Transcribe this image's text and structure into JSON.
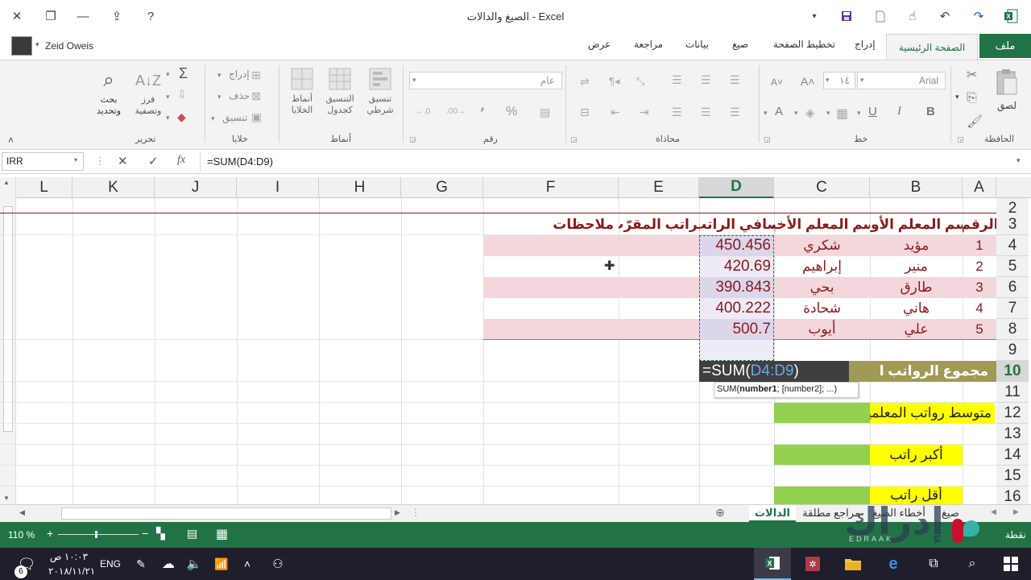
{
  "window": {
    "title": "الصيغ والدالات - Excel",
    "help": "?"
  },
  "account": {
    "name": "Zeid Oweis"
  },
  "ribbon_tabs": [
    "ملف",
    "الصفحة الرئيسية",
    "إدراج",
    "تخطيط الصفحة",
    "صيغ",
    "بيانات",
    "مراجعة",
    "عرض"
  ],
  "ribbon": {
    "groups": {
      "clipboard": "الحافظة",
      "font": "خط",
      "alignment": "محاذاة",
      "number": "رقم",
      "styles": "أنماط",
      "cells": "خلايا",
      "editing": "تحرير"
    },
    "paste": "لصق",
    "font_name": "Arial",
    "font_size": "١٤",
    "number_format": "عام",
    "cond_format": "تنسيق شرطي",
    "format_table": "التنسيق كجدول",
    "cell_styles": "أنماط الخلايا",
    "insert": "إدراج",
    "delete": "حذف",
    "format": "تنسيق",
    "sort_filter": "فرز وتصفية",
    "find_select": "بحث وتحديد",
    "bold": "B",
    "italic": "I",
    "underline": "U",
    "percent": "%",
    "comma": "٬"
  },
  "formula_bar": {
    "name_box": "IRR",
    "fx": "fx",
    "formula": "=SUM(D4:D9)"
  },
  "columns": [
    "L",
    "K",
    "J",
    "I",
    "H",
    "G",
    "F",
    "E",
    "D",
    "C",
    "B",
    "A"
  ],
  "rows": [
    "2",
    "3",
    "4",
    "5",
    "6",
    "7",
    "8",
    "9",
    "10",
    "11",
    "12",
    "13",
    "14",
    "15",
    "16"
  ],
  "headers": {
    "A": "الرقم",
    "B": "اسم المعلم الأول",
    "C": "اسم المعلم الأخير",
    "D": "صافي الراتب",
    "E": "الراتب المقرّب",
    "F": "ملاحظات"
  },
  "table_rows": [
    {
      "num": "1",
      "first": "مؤيد",
      "last": "شكري",
      "salary": "450.456"
    },
    {
      "num": "2",
      "first": "منير",
      "last": "إبراهيم",
      "salary": "420.69"
    },
    {
      "num": "3",
      "first": "طارق",
      "last": "بحي",
      "salary": "390.843"
    },
    {
      "num": "4",
      "first": "هاني",
      "last": "شحادة",
      "salary": "400.222"
    },
    {
      "num": "5",
      "first": "علي",
      "last": "أيوب",
      "salary": "500.7"
    }
  ],
  "summary": {
    "total_label": "مجموع الرواتب ا",
    "formula_prefix": "=SUM(",
    "formula_ref": "D4:D9",
    "formula_suffix": ")",
    "tooltip_fn": "SUM(",
    "tooltip_arg1": "number1",
    "tooltip_rest": "; [number2]; ...)",
    "avg_label": "متوسط رواتب المعلمين",
    "max_label": "أكبر راتب",
    "min_label": "أقل راتب"
  },
  "sheet_tabs": [
    "الدالات",
    "مراجع مطلقة",
    "أخطاء الصيغ",
    "صيغ"
  ],
  "status": {
    "mode": "نقطة",
    "zoom": "110 %"
  },
  "watermark": {
    "text": "إدراك",
    "sub": "EDRAAK"
  },
  "taskbar": {
    "time": "١٠:٠٣ ص",
    "date": "٢٠١٨/١١/٢١",
    "lang": "ENG",
    "badge": "6"
  },
  "colors": {
    "excel_green": "#217346",
    "pink_row": "#f2d7db",
    "header_red": "#8b1a1a",
    "olive": "#a09a55",
    "lime": "#92d050",
    "yellow": "#ffff00"
  }
}
